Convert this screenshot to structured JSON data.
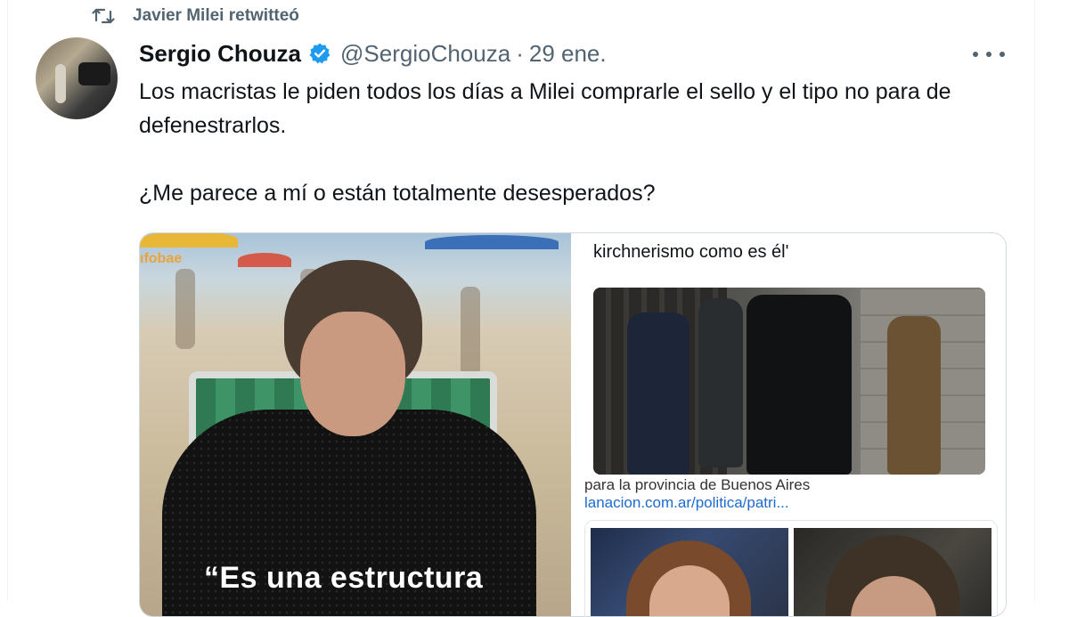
{
  "retweet": {
    "icon": "retweet-icon",
    "text": "Javier Milei retwitteó"
  },
  "author": {
    "name": "Sergio Chouza",
    "verified_icon": "verified-badge-icon",
    "handle": "@SergioChouza",
    "separator": "·",
    "date": "29 ene."
  },
  "more_icon": "more-options-icon",
  "tweet": {
    "text": "Los macristas le piden todos los días a Milei comprarle el sello y el tipo no para de defenestrarlos.\n\n¿Me parece a mí o están totalmente desesperados?"
  },
  "media": {
    "left_image": {
      "brand_text": "ıfobae",
      "caption_line1": "“Es una estructura",
      "caption_line2": "…"
    },
    "right_image": {
      "top_text": "kirchnerismo como es él'",
      "photo_caption": "para la provincia de Buenos Aires",
      "link_text": "lanacion.com.ar/politica/patri..."
    }
  },
  "colors": {
    "text_primary": "#0f1419",
    "text_secondary": "#536471",
    "verified_blue": "#1d9bf0",
    "link_blue": "#1d6bd1"
  }
}
